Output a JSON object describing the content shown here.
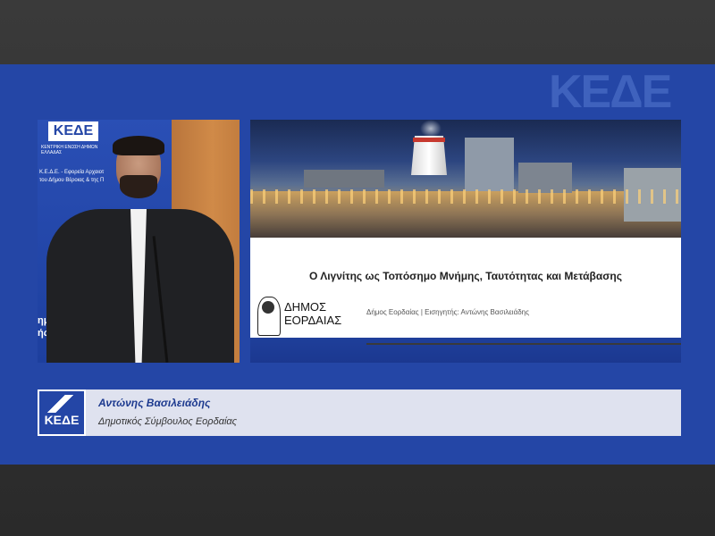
{
  "watermark": {
    "text": "ΚΕΔΕ"
  },
  "video": {
    "banner_logo": "ΚΕΔΕ",
    "banner_sub": "ΚΕΝΤΡΙΚΗ ΕΝΩΣΗ ΔΗΜΩΝ ΕΛΛΑΔΑΣ",
    "banner_line1": "Κ.Ε.Δ.Ε. - Εφορεία Αρχαιοτ",
    "banner_line2": "του Δήμου Βέροιας & της Π",
    "banner_big1": "ημ",
    "banner_big2": "ής Κ"
  },
  "slide": {
    "title": "Ο Λιγνίτης ως Τοπόσημο Μνήμης, Ταυτότητας και Μετάβασης",
    "logo_line1": "ΔΗΜΟΣ",
    "logo_line2": "ΕΟΡΔΑΙΑΣ",
    "footer": "Δήμος Εορδαίας | Εισηγητής: Αντώνης Βασιλειάδης"
  },
  "lower_third": {
    "logo_text": "ΚΕΔΕ",
    "name": "Αντώνης Βασιλειάδης",
    "role": "Δημοτικός Σύμβουλος Εορδαίας"
  }
}
